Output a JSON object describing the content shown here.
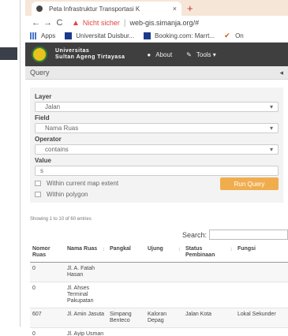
{
  "browser": {
    "tab_title": "Peta Infrastruktur Transportasi K",
    "tab_close": "×",
    "new_tab": "+",
    "back": "←",
    "forward": "→",
    "reload": "C",
    "warning_icon": "▲",
    "not_secure": "Nicht sicher",
    "separator": "|",
    "url": "web-gis.simanja.org/#",
    "bookmarks": [
      {
        "label": "Apps",
        "icon": "apps-grid-icon",
        "color": "#4a76c9"
      },
      {
        "label": "Universitat Duisbur...",
        "icon": "bookmark-favicon-icon",
        "color": "#1b3a8c"
      },
      {
        "label": "Booking.com: Marrt...",
        "icon": "booking-favicon-icon",
        "color": "#1b3a8c"
      },
      {
        "label": "On",
        "icon": "bookmark-check-icon",
        "color": "#d35400"
      }
    ]
  },
  "header": {
    "brand_line1": "Universitas",
    "brand_line2": "Sultan Ageng Tirtayasa",
    "nav": [
      {
        "label": "About",
        "icon": "info-icon",
        "glyph": "●"
      },
      {
        "label": "Tools ▾",
        "icon": "wrench-icon",
        "glyph": "✎"
      }
    ]
  },
  "query": {
    "title": "Query",
    "collapse": "◂",
    "layer_label": "Layer",
    "layer_value": "Jalan",
    "field_label": "Field",
    "field_value": "Nama Ruas",
    "operator_label": "Operator",
    "operator_value": "contains",
    "value_label": "Value",
    "value_input": "s",
    "dropdown_caret": "▾",
    "within_extent": "Within current map extent",
    "within_polygon": "Within polygon",
    "run_button": "Run Query"
  },
  "results": {
    "showing": "Showing 1 to 10 of 60 entries",
    "search_label": "Search:",
    "sort_glyph": "↕",
    "columns": [
      "Nomor Ruas",
      "Nama Ruas",
      "Pangkal",
      "Ujung",
      "Status Pembinaan",
      "Fungsi"
    ],
    "rows": [
      [
        "0",
        "Jl. A. Fatah Hasan",
        "",
        "",
        "",
        ""
      ],
      [
        "0",
        "Jl. Ahses Terminal Pakupatan",
        "",
        "",
        "",
        ""
      ],
      [
        "607",
        "Jl. Amin Jasuta",
        "Simpang Benteco",
        "Kaloran Depag",
        "Jalan Kota",
        "Lokal Sekunder"
      ],
      [
        "0",
        "Jl. Ayip Usman",
        "",
        "",
        "",
        ""
      ]
    ]
  },
  "colors": {
    "header_bg": "#3f3f3f",
    "run_button": "#f0ad4e",
    "tabbar_bg": "#f6e6d8",
    "warning": "#dd4444"
  }
}
